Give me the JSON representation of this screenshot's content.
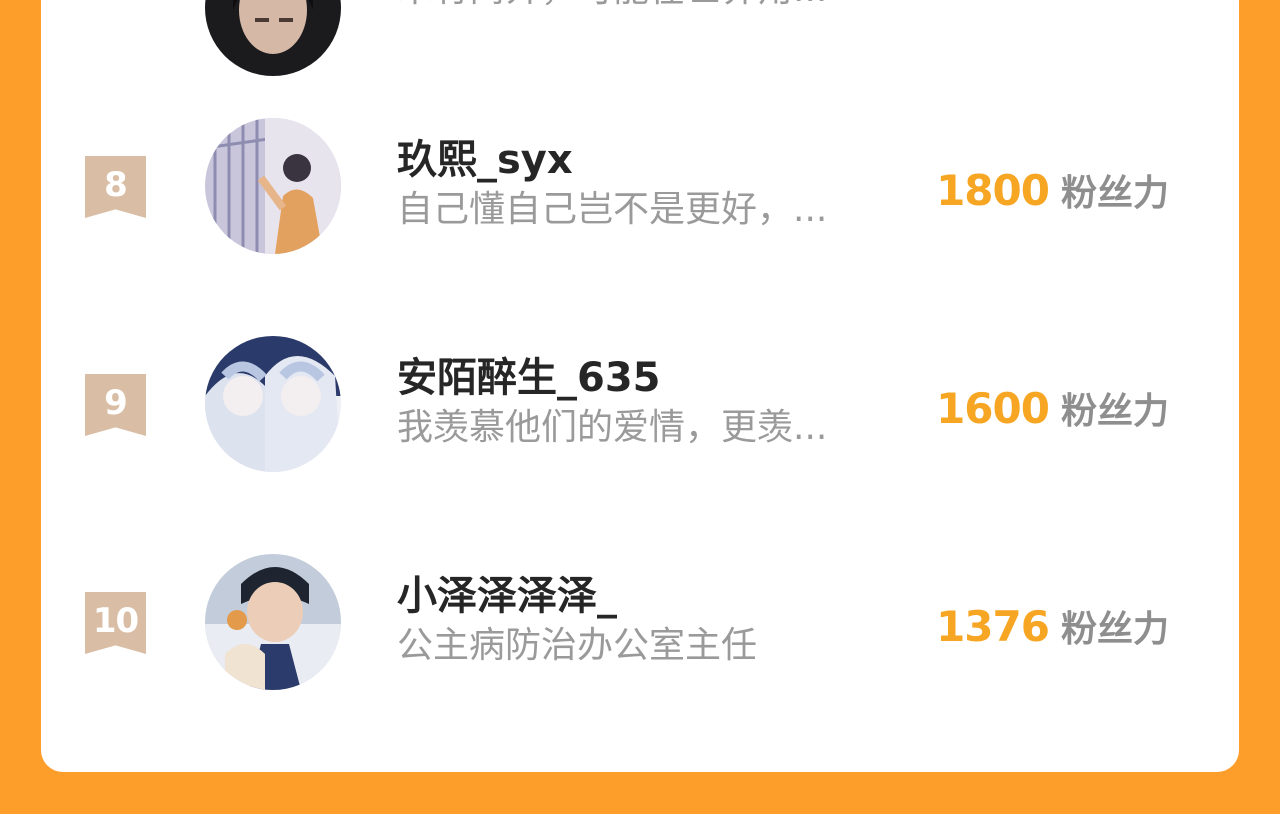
{
  "leaderboard": {
    "partial_item": {
      "bio": "木有简介，可能在世界角..."
    },
    "items": [
      {
        "rank": "8",
        "name": "玖熙_syx",
        "bio": "自己懂自己岂不是更好，...",
        "fans": "1800",
        "fans_unit": "粉丝力"
      },
      {
        "rank": "9",
        "name": "安陌醉生_635",
        "bio": "我羡慕他们的爱情，更羡...",
        "fans": "1600",
        "fans_unit": "粉丝力"
      },
      {
        "rank": "10",
        "name": "小泽泽泽泽_",
        "bio": "公主病防治办公室主任",
        "fans": "1376",
        "fans_unit": "粉丝力"
      }
    ]
  },
  "colors": {
    "background": "#FD9E2A",
    "card": "#FFFFFF",
    "rank_badge": "#D9BEA5",
    "fans_number": "#F6A623",
    "name": "#262626",
    "bio": "#9A9A9A"
  }
}
